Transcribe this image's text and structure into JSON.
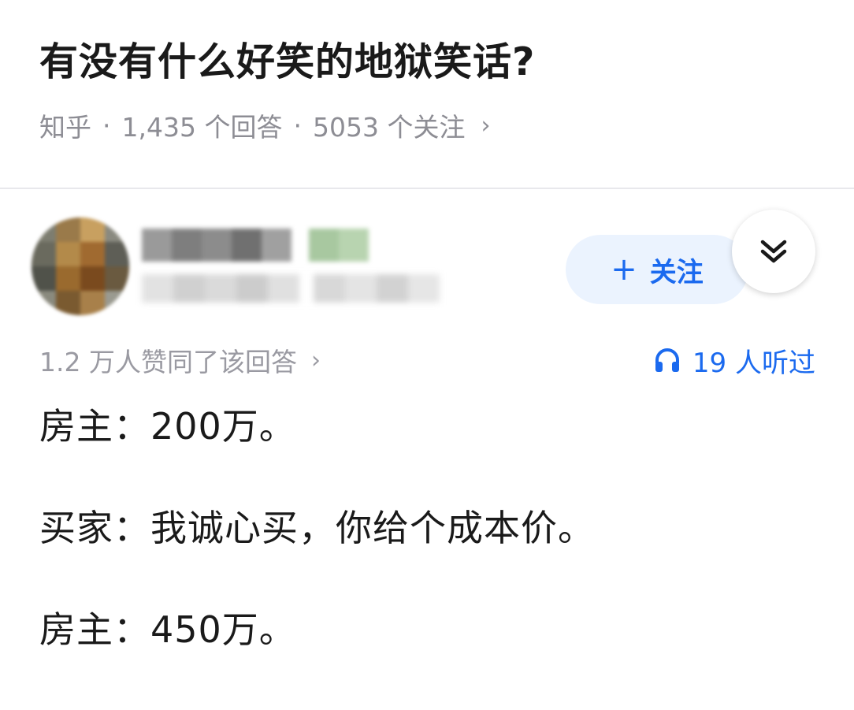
{
  "question": {
    "title": "有没有什么好笑的地狱笑话?",
    "source": "知乎",
    "answers_count": "1,435 个回答",
    "followers_count": "5053 个关注",
    "meta_chevron": "›"
  },
  "author": {
    "follow_plus": "+",
    "follow_label": "关注",
    "collapse_icon": "double-chevron-down-icon"
  },
  "answer": {
    "upvote_text": "1.2 万人赞同了该回答",
    "upvote_chevron": "›",
    "listen_text": "19 人听过",
    "listen_icon": "headphones-icon",
    "lines": [
      "房主：200万。",
      "买家：我诚心买，你给个成本价。",
      "房主：450万。"
    ]
  },
  "colors": {
    "accent_blue": "#1b6aef",
    "follow_bg": "#ebf3fe",
    "text_primary": "#1a1a1a",
    "text_secondary": "#8d8d94"
  }
}
